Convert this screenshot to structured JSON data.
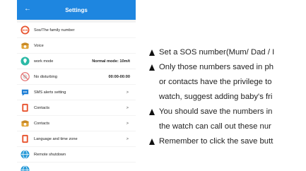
{
  "appbar": {
    "title": "Settings",
    "back_glyph": "←"
  },
  "settings": [
    {
      "label": "Sos/The family number",
      "icon": "sos-icon",
      "value": "",
      "arrow": ""
    },
    {
      "label": "Voice",
      "icon": "phone-icon",
      "value": "",
      "arrow": ""
    },
    {
      "label": "work mode",
      "icon": "location-icon",
      "value": "Normal mode: 10m/t",
      "arrow": ""
    },
    {
      "label": "No disturbing",
      "icon": "do-not-disturb-icon",
      "value": "00:00-00:00",
      "arrow": ""
    },
    {
      "label": "SMS alerts setting",
      "icon": "chat-bubble-icon",
      "value": "",
      "arrow": ">"
    },
    {
      "label": "Contacts",
      "icon": "phonebook-icon",
      "value": "",
      "arrow": ">"
    },
    {
      "label": "Contacts",
      "icon": "phone-icon",
      "value": "",
      "arrow": ">"
    },
    {
      "label": "Language and time zone",
      "icon": "phonebook-icon",
      "value": "",
      "arrow": ">"
    },
    {
      "label": "Remote shutdown",
      "icon": "globe-icon",
      "value": "",
      "arrow": ""
    },
    {
      "label": "",
      "icon": "globe-icon",
      "value": "",
      "arrow": ""
    }
  ],
  "notes": [
    "Set a SOS number(Mum/ Dad / I",
    "Only those numbers saved in ph",
    "or contacts have the privilege to",
    "watch, suggest adding baby's fri",
    "You should save the numbers in",
    "the watch can call out these nur",
    "Remember to click the save butt"
  ],
  "notes_bullets": [
    true,
    true,
    false,
    false,
    true,
    false,
    true
  ],
  "colors": {
    "appbar": "#1e86e0",
    "sos": "#e8532e",
    "phone": "#e0a43a",
    "location": "#2bb9a6",
    "chat": "#1f7fd6",
    "book": "#e8532e",
    "globe": "#2a9bd8"
  }
}
